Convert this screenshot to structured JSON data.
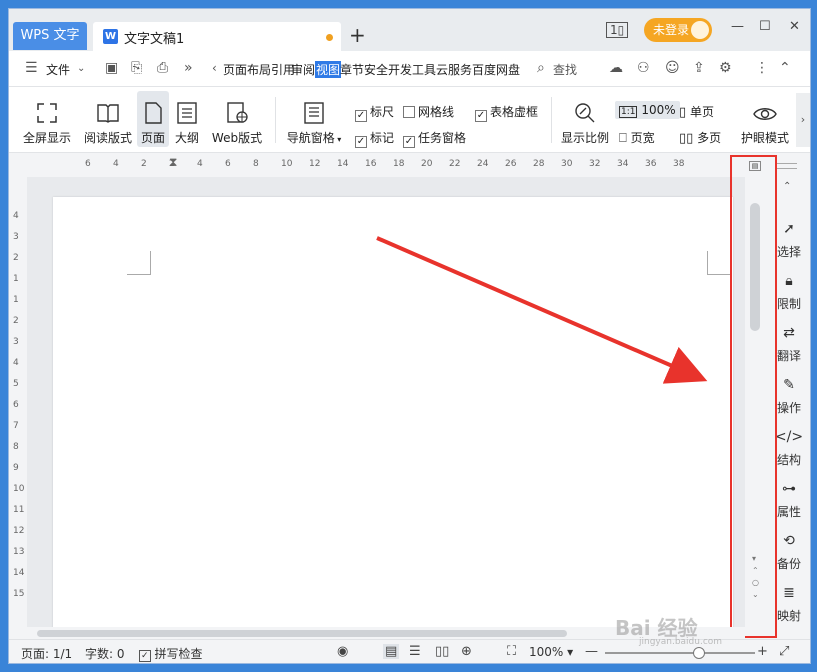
{
  "titlebar": {
    "app_tab": "WPS 文字",
    "doc_tab": "文字文稿1",
    "doc_tab_icon": "W",
    "new_tab": "+",
    "login": "未登录",
    "minimize": "—",
    "maximize": "☐",
    "close": "✕"
  },
  "menu": {
    "file": "文件",
    "tabs": [
      "页面布局",
      "引用",
      "审阅",
      "视图",
      "章节",
      "安全",
      "开发工具",
      "云服务",
      "百度网盘"
    ],
    "active_tab": "视图",
    "search": "查找"
  },
  "ribbon": {
    "fullscreen": "全屏显示",
    "reading": "阅读版式",
    "page": "页面",
    "outline": "大纲",
    "web": "Web版式",
    "nav_pane": "导航窗格",
    "ruler": "标尺",
    "gridlines": "网格线",
    "table_dash": "表格虚框",
    "marks": "标记",
    "task_pane": "任务窗格",
    "zoom_ratio": "显示比例",
    "zoom_100": "100%",
    "zoom_100_badge": "1:1",
    "single_page": "单页",
    "page_width": "页宽",
    "multi_page": "多页",
    "eye_mode": "护眼模式"
  },
  "checkboxes": {
    "ruler": true,
    "gridlines": false,
    "table_dash": true,
    "marks": true,
    "task_pane": true
  },
  "ruler_h": [
    "6",
    "4",
    "2",
    "2",
    "4",
    "6",
    "8",
    "10",
    "12",
    "14",
    "16",
    "18",
    "20",
    "22",
    "24",
    "26",
    "28",
    "30",
    "32",
    "34",
    "36",
    "38"
  ],
  "ruler_v": [
    "4",
    "3",
    "2",
    "1",
    "1",
    "2",
    "3",
    "4",
    "5",
    "6",
    "7",
    "8",
    "9",
    "10",
    "11",
    "12",
    "13",
    "14",
    "15"
  ],
  "side_panel": {
    "items": [
      "选择",
      "限制",
      "翻译",
      "操作",
      "结构",
      "属性",
      "备份",
      "映射"
    ]
  },
  "status": {
    "page": "页面: 1/1",
    "words": "字数: 0",
    "spell": "拼写检查",
    "zoom": "100%"
  },
  "watermark": "Bai 经验",
  "watermark_sub": "jingyan.baidu.com",
  "colors": {
    "accent": "#2f7ae6",
    "login_orange": "#f5a623",
    "highlight_red": "#e8332c"
  }
}
